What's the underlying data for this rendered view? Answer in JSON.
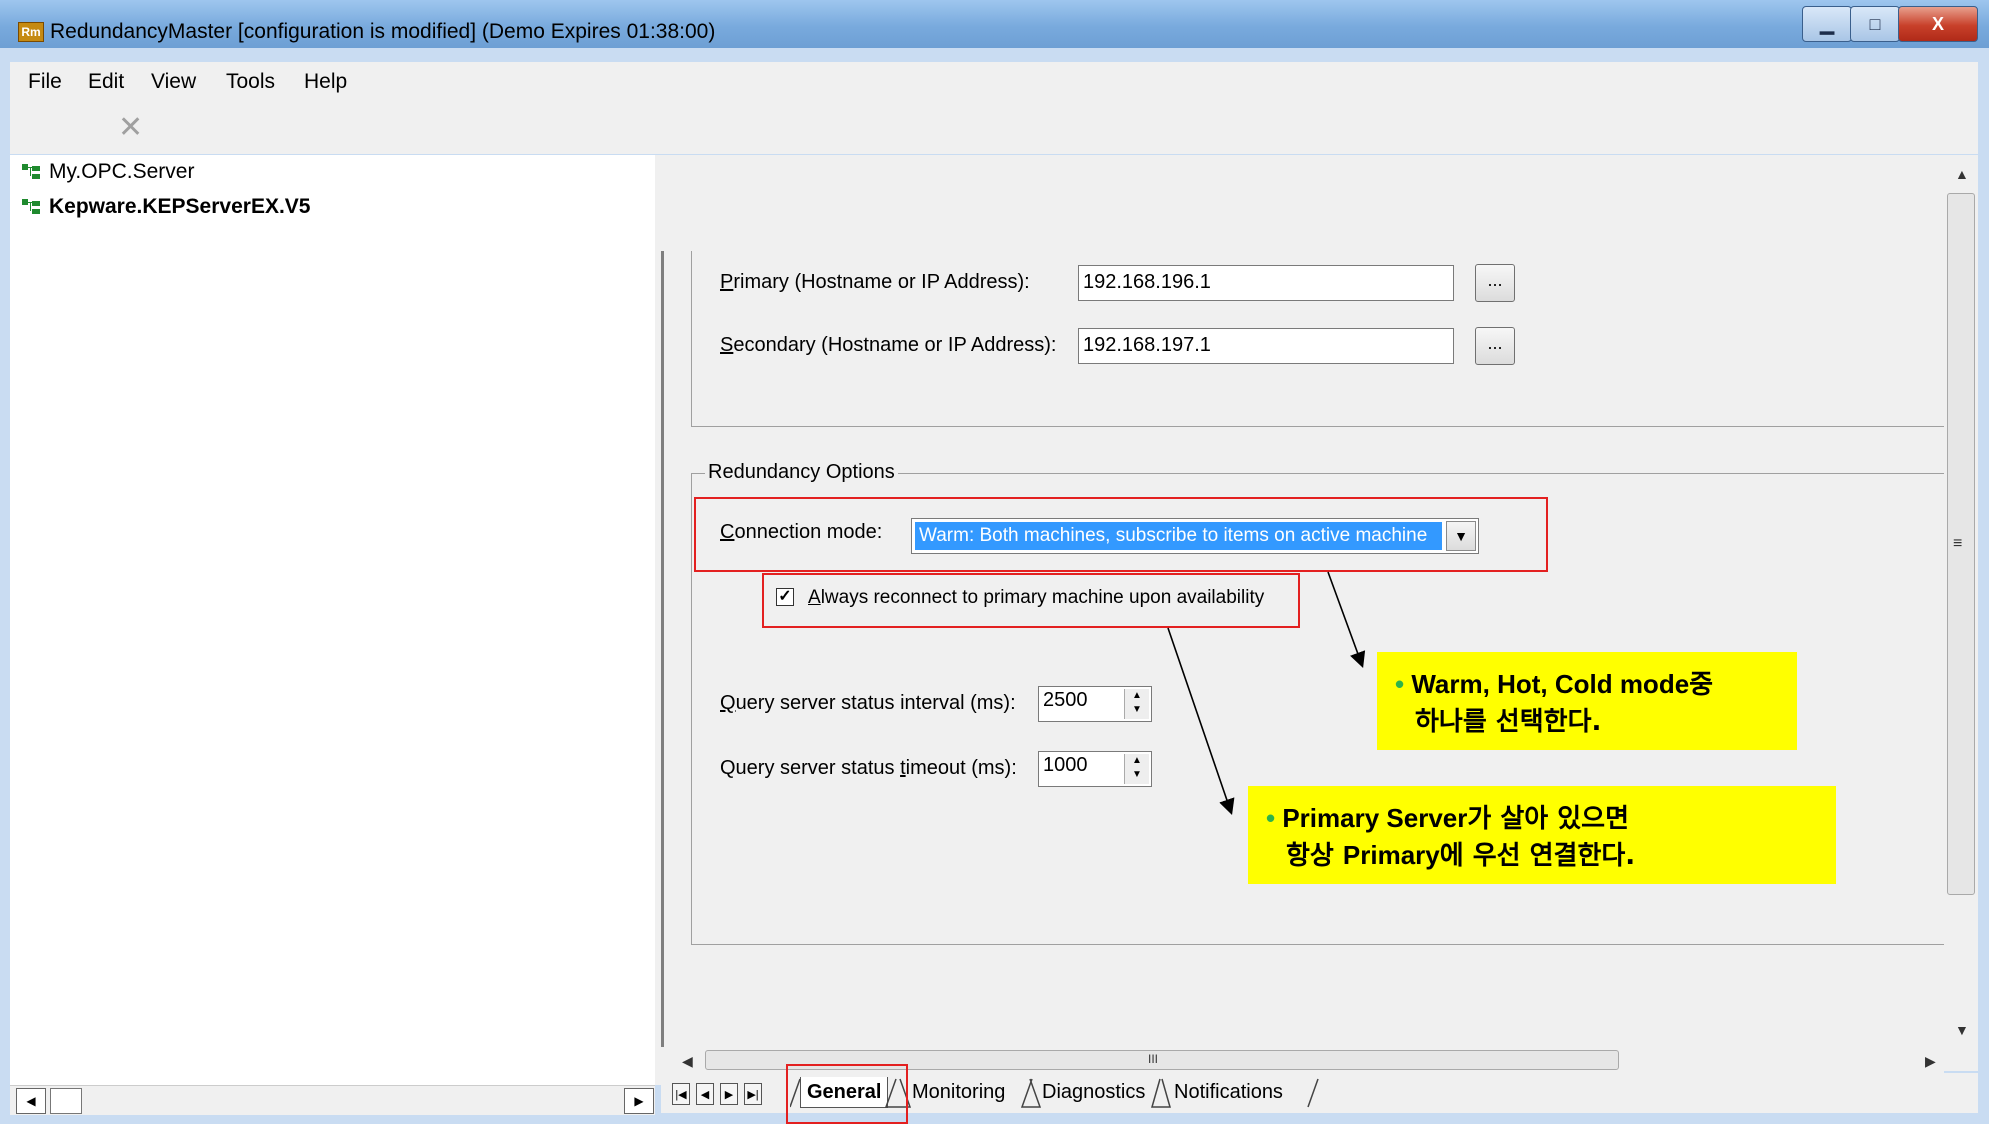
{
  "window": {
    "app_icon_text": "Rm",
    "title": "RedundancyMaster [configuration is modified] (Demo Expires 01:38:00)",
    "minimize_glyph": "▁",
    "maximize_glyph": "□",
    "close_glyph": "X"
  },
  "menu": {
    "file": "File",
    "edit": "Edit",
    "view": "View",
    "tools": "Tools",
    "help": "Help"
  },
  "toolbar": {
    "delete_glyph": "✕"
  },
  "tree": {
    "items": [
      {
        "label": "My.OPC.Server"
      },
      {
        "label": "Kepware.KEPServerEX.V5"
      }
    ]
  },
  "servers": {
    "primary_label_key": "P",
    "primary_label_rest": "rimary (Hostname or IP Address):",
    "primary_value": "192.168.196.1",
    "secondary_label_key": "S",
    "secondary_label_rest": "econdary (Hostname or IP Address):",
    "secondary_value": "192.168.197.1",
    "browse_label": "..."
  },
  "redundancy": {
    "group_title": "Redundancy Options",
    "connection_label_key": "C",
    "connection_label_rest": "onnection mode:",
    "connection_value": "Warm: Both machines, subscribe to items on active machine",
    "reconnect_checked_glyph": "✓",
    "reconnect_label_key": "A",
    "reconnect_label_rest": "lways reconnect to primary machine upon availability",
    "interval_label_key": "Q",
    "interval_label_rest": "uery server status interval (ms):",
    "interval_value": "2500",
    "timeout_label_pre": "Query server status ",
    "timeout_label_key": "t",
    "timeout_label_rest": "imeout (ms):",
    "timeout_value": "1000"
  },
  "annotations": {
    "bullet": "•",
    "mode_note_bold": "Warm, Hot, Cold mode",
    "mode_note_ko1": "중",
    "mode_note_ko2": "하나를 선택한다.",
    "primary_note_bold": "Primary Server",
    "primary_note_ko1": "가 살아 있으면",
    "primary_note_ko2_pre": "항상 ",
    "primary_note_bold2": "Primary",
    "primary_note_ko2_post": "에 우선 연결한다."
  },
  "tabs": {
    "nav_first": "|◀",
    "nav_prev": "◀",
    "nav_next": "▶",
    "nav_last": "▶|",
    "general": "General",
    "monitoring": "Monitoring",
    "diagnostics": "Diagnostics",
    "notifications": "Notifications"
  },
  "scroll": {
    "up": "▲",
    "down": "▼",
    "left": "◀",
    "right": "▶",
    "grip": "≡",
    "hgrip": "III"
  }
}
